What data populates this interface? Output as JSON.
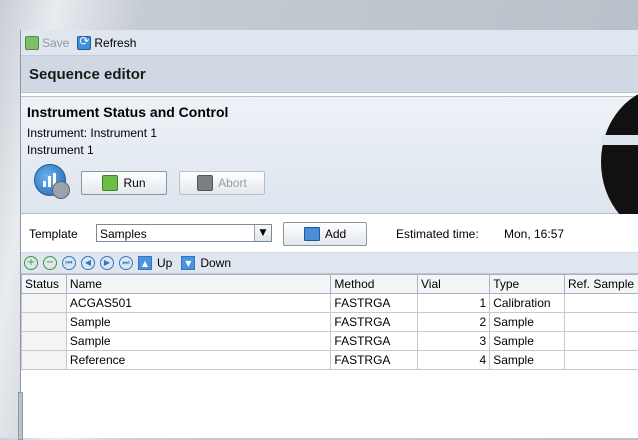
{
  "toolbar": {
    "save_label": "Save",
    "refresh_label": "Refresh"
  },
  "title": "Sequence editor",
  "status_panel": {
    "heading": "Instrument Status and Control",
    "instrument_line": "Instrument: Instrument 1",
    "instrument_name": "Instrument 1",
    "run_label": "Run",
    "abort_label": "Abort"
  },
  "template": {
    "label": "Template",
    "selected": "Samples",
    "add_label": "Add",
    "estimated_label": "Estimated time:",
    "estimated_value": "Mon, 16:57"
  },
  "nav": {
    "up_label": "Up",
    "down_label": "Down"
  },
  "table": {
    "headers": [
      "Status",
      "Name",
      "Method",
      "Vial",
      "Type",
      "Ref. Sample"
    ],
    "rows": [
      [
        "",
        "ACGAS501",
        "FASTRGA",
        "1",
        "Calibration",
        ""
      ],
      [
        "",
        "Sample",
        "FASTRGA",
        "2",
        "Sample",
        ""
      ],
      [
        "",
        "Sample",
        "FASTRGA",
        "3",
        "Sample",
        ""
      ],
      [
        "",
        "Reference",
        "FASTRGA",
        "4",
        "Sample",
        ""
      ]
    ]
  }
}
